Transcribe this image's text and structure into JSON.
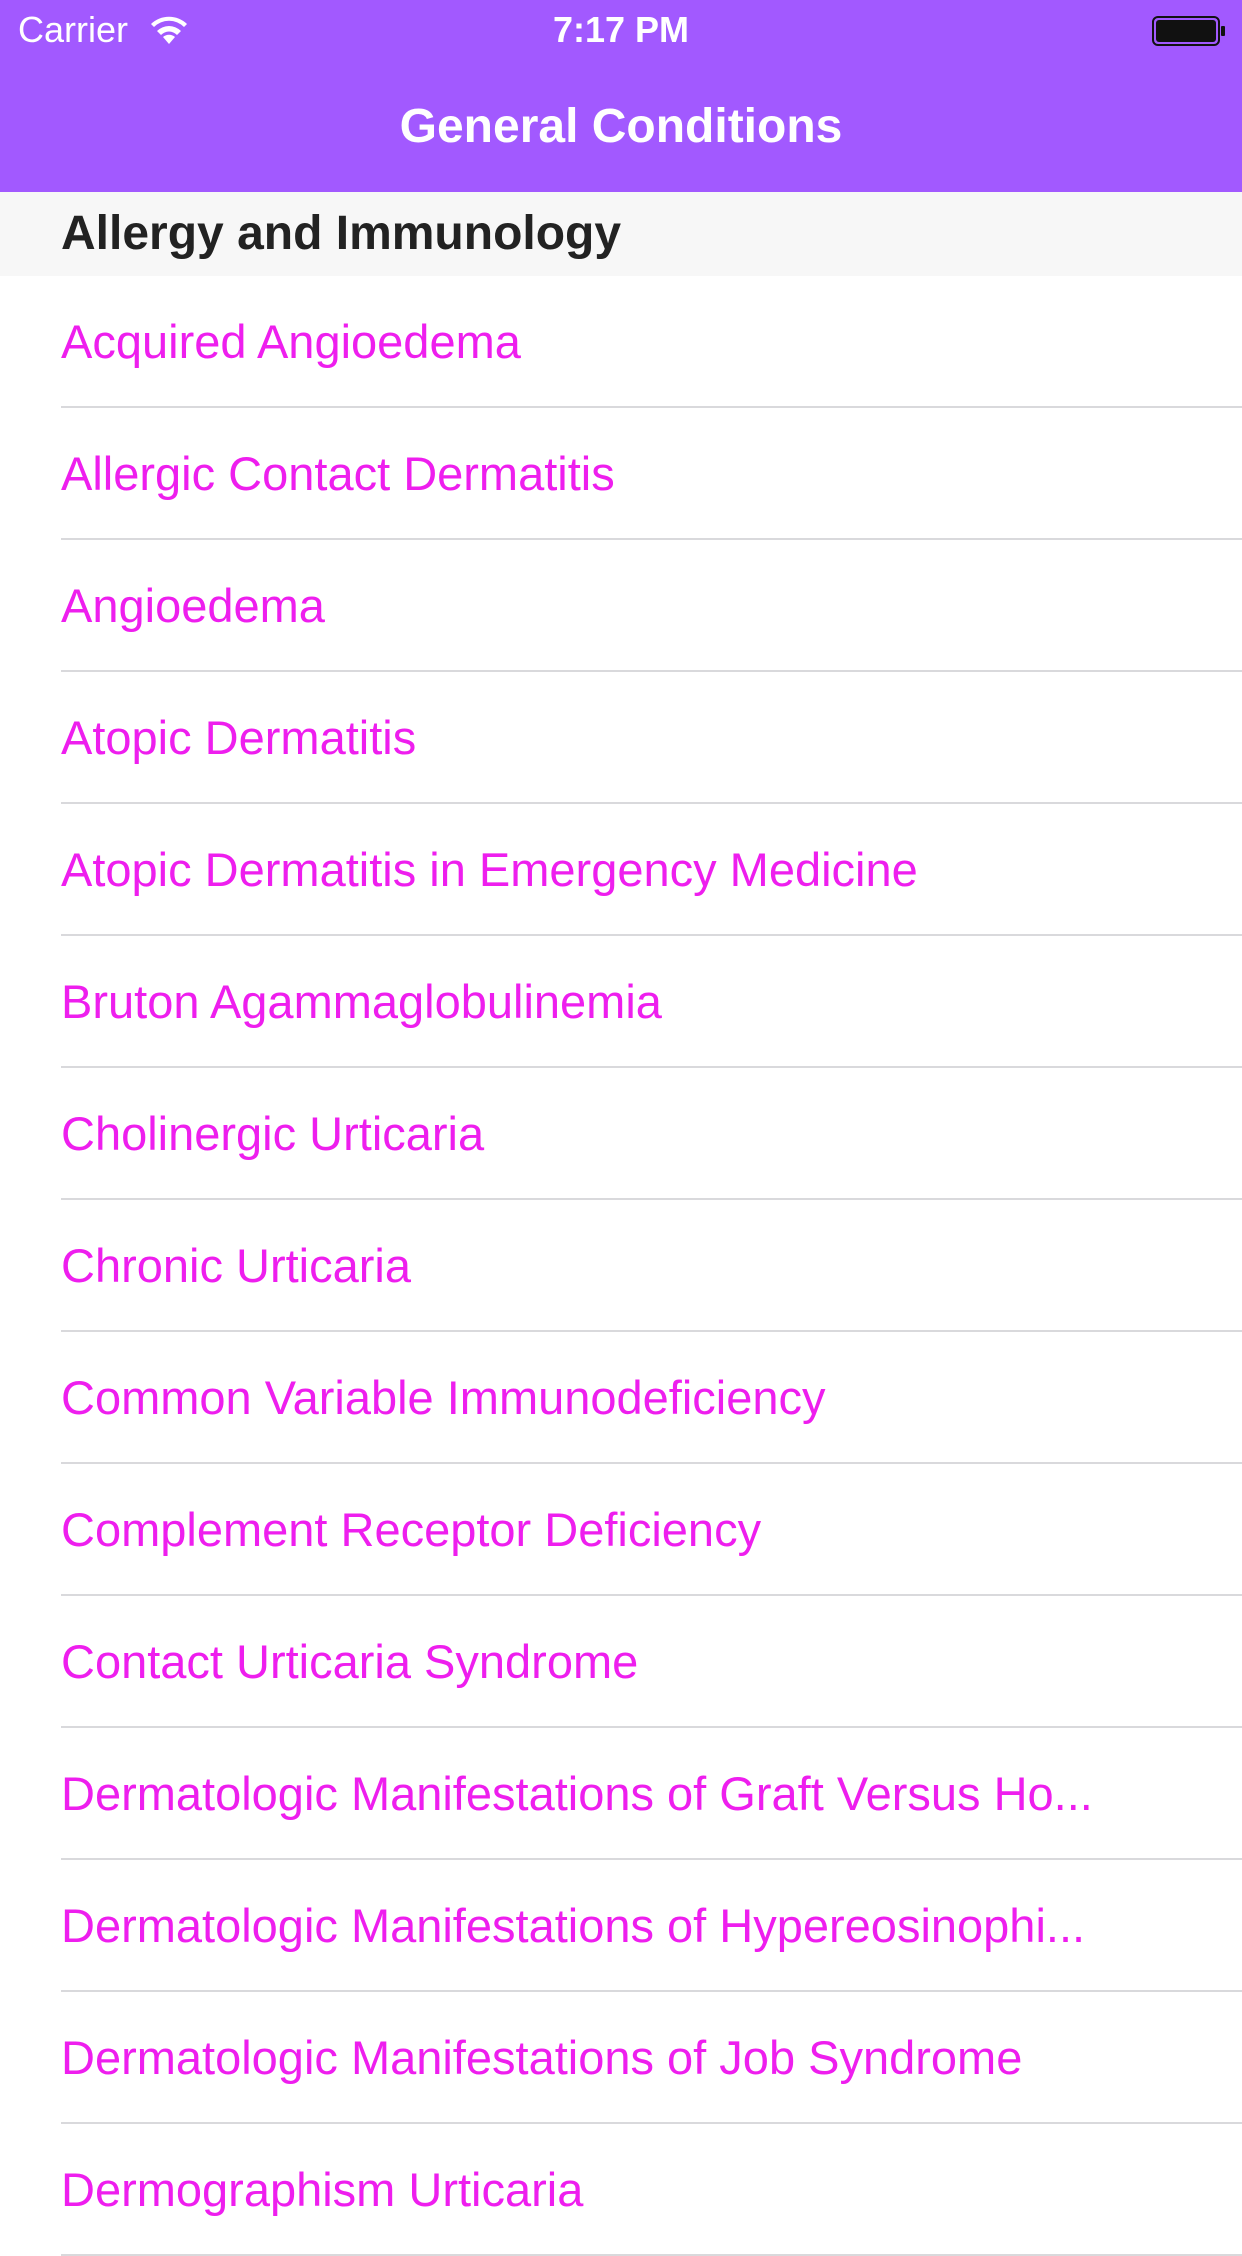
{
  "status_bar": {
    "carrier": "Carrier",
    "time": "7:17 PM",
    "icons": [
      "wifi-icon",
      "battery-icon"
    ]
  },
  "nav_bar": {
    "title": "General Conditions",
    "background_color": "#a259ff"
  },
  "section": {
    "title": "Allergy and Immunology"
  },
  "list": {
    "text_color": "#ee1eee",
    "items": [
      "Acquired Angioedema",
      "Allergic Contact Dermatitis",
      "Angioedema",
      "Atopic Dermatitis",
      "Atopic Dermatitis in Emergency Medicine",
      "Bruton Agammaglobulinemia",
      "Cholinergic Urticaria",
      "Chronic Urticaria",
      "Common Variable Immunodeficiency",
      "Complement Receptor Deficiency",
      "Contact Urticaria Syndrome",
      "Dermatologic Manifestations of Graft Versus Ho...",
      "Dermatologic Manifestations of Hypereosinophi...",
      "Dermatologic Manifestations of Job Syndrome",
      "Dermographism Urticaria"
    ]
  }
}
